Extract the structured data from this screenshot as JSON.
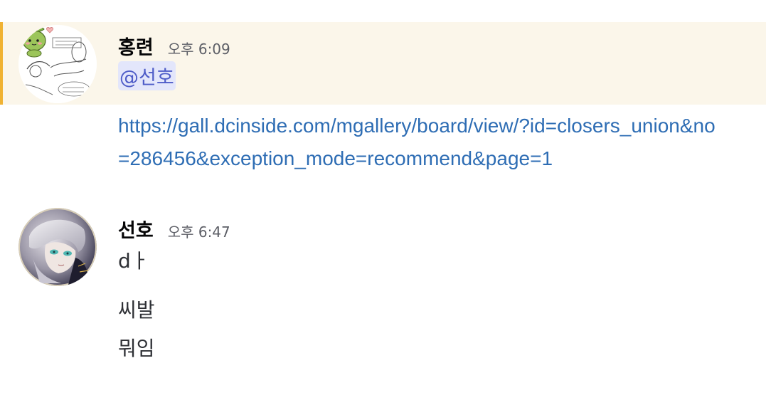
{
  "messages": [
    {
      "username": "홍련",
      "timestamp": "오후 6:09",
      "avatar_icon": "chibi-sprout-avatar",
      "mention": "@선호",
      "link": "https://gall.dcinside.com/mgallery/board/view/?id=closers_union&no=286456&exception_mode=recommend&page=1",
      "highlighted": true,
      "highlight_color": "#fbf6ea",
      "highlight_bar_color": "#f0b232"
    },
    {
      "username": "선호",
      "timestamp": "오후 6:47",
      "avatar_icon": "anime-character-avatar",
      "lines": [
        "dㅏ",
        "씨발",
        "뭐임"
      ]
    }
  ],
  "colors": {
    "link": "#2e6db4",
    "mention_text": "#4e5cc8",
    "mention_bg": "#e3e6fb",
    "timestamp": "#5c5e66"
  }
}
